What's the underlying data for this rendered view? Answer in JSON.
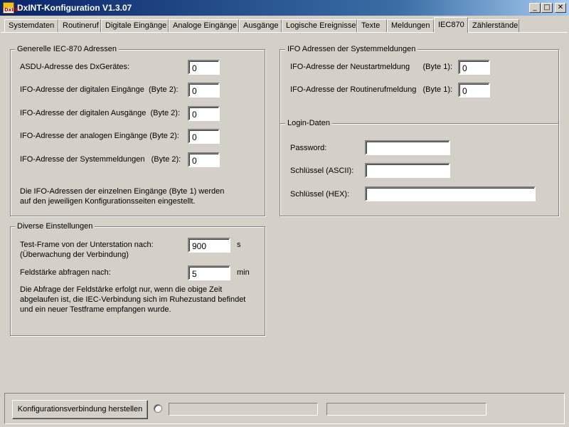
{
  "window": {
    "title": "DxINT-Konfiguration V1.3.07",
    "icon_text": "DxINT",
    "minimize_symbol": "_",
    "maximize_symbol": "□",
    "close_symbol": "✕"
  },
  "tabs": [
    {
      "label": "Systemdaten"
    },
    {
      "label": "Routineruf"
    },
    {
      "label": "Digitale Eingänge"
    },
    {
      "label": "Analoge Eingänge"
    },
    {
      "label": "Ausgänge"
    },
    {
      "label": "Logische Ereignisse"
    },
    {
      "label": "Texte"
    },
    {
      "label": "Meldungen"
    },
    {
      "label": "IEC870",
      "active": true
    },
    {
      "label": "Zählerstände"
    }
  ],
  "general": {
    "legend": "Generelle IEC-870 Adressen",
    "rows": [
      {
        "label": "ASDU-Adresse des DxGerätes:",
        "value": "0"
      },
      {
        "label": "IFO-Adresse der digitalen Eingänge  (Byte 2):",
        "value": "0"
      },
      {
        "label": "IFO-Adresse der digitalen Ausgänge  (Byte 2):",
        "value": "0"
      },
      {
        "label": "IFO-Adresse der analogen Eingänge (Byte 2):",
        "value": "0"
      },
      {
        "label": "IFO-Adresse der Systemmeldungen   (Byte 2):",
        "value": "0"
      }
    ],
    "note_line1": "Die IFO-Adressen der einzelnen Eingänge (Byte 1) werden",
    "note_line2": "auf den jeweiligen Konfigurationsseiten eingestellt."
  },
  "diverse": {
    "legend": "Diverse Einstellungen",
    "testframe_label1": "Test-Frame von der Unterstation nach:",
    "testframe_label2": "(Überwachung der Verbindung)",
    "testframe_value": "900",
    "testframe_unit": "s",
    "feld_label": "Feldstärke abfragen nach:",
    "feld_value": "5",
    "feld_unit": "min",
    "note_line1": "Die Abfrage der Feldstärke erfolgt nur, wenn die obige Zeit",
    "note_line2": "abgelaufen ist, die IEC-Verbindung sich im Ruhezustand befindet",
    "note_line3": "und ein neuer Testframe empfangen wurde."
  },
  "system_msgs": {
    "legend": "IFO Adressen der Systemmeldungen",
    "rows": [
      {
        "label": "IFO-Adresse der Neustartmeldung      (Byte 1):",
        "value": "0"
      },
      {
        "label": "IFO-Adresse der Routinerufmeldung   (Byte 1):",
        "value": "0"
      }
    ]
  },
  "login": {
    "legend": "Login-Daten",
    "password_label": "Password:",
    "password_value": "",
    "key_ascii_label": "Schlüssel (ASCII):",
    "key_ascii_value": "",
    "key_hex_label": "Schlüssel (HEX):",
    "key_hex_value": ""
  },
  "bottom": {
    "connect_button": "Konfigurationsverbindung herstellen",
    "status1": "",
    "status2": ""
  },
  "colors": {
    "titlebar_start": "#0a246a",
    "titlebar_end": "#a6caf0",
    "face": "#d4d0c8"
  }
}
